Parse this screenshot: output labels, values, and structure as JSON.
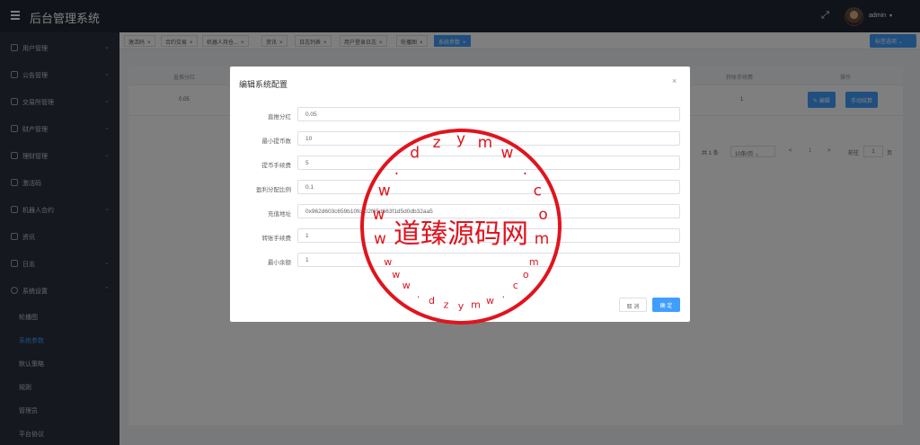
{
  "app": {
    "title": "后台管理系统",
    "user": "admin"
  },
  "sidebar": {
    "items": [
      {
        "label": "用户管理"
      },
      {
        "label": "公告管理"
      },
      {
        "label": "交易所管理"
      },
      {
        "label": "财产管理"
      },
      {
        "label": "理财管理"
      },
      {
        "label": "激活码"
      },
      {
        "label": "机器人合约"
      },
      {
        "label": "资讯"
      },
      {
        "label": "日志"
      },
      {
        "label": "系统设置"
      }
    ],
    "sub_items": [
      {
        "label": "轮播图"
      },
      {
        "label": "系统参数"
      },
      {
        "label": "默认策略"
      },
      {
        "label": "规则"
      },
      {
        "label": "管理员"
      },
      {
        "label": "平台协议"
      }
    ]
  },
  "tabs": [
    {
      "label": "激活码"
    },
    {
      "label": "合约交易"
    },
    {
      "label": "机器人持仓..."
    },
    {
      "label": "资讯"
    },
    {
      "label": "日志列表"
    },
    {
      "label": "用户登录日志"
    },
    {
      "label": "轮播图"
    },
    {
      "label": "系统参数"
    }
  ],
  "tab_options": "标签选项",
  "table": {
    "headers": {
      "direct_bonus": "直推分红",
      "transfer_fee": "转账手续费",
      "actions": "操作"
    },
    "row": {
      "direct_bonus": "0.05",
      "transfer_fee": "1"
    },
    "edit_label": "编辑",
    "manual_label": "手动结算"
  },
  "pagination": {
    "total": "共 1 条",
    "page_size": "10条/页",
    "prev": "<",
    "page": "1",
    "next": ">",
    "goto": "前往",
    "goto_value": "1",
    "page_unit": "页"
  },
  "dialog": {
    "title": "编辑系统配置",
    "fields": [
      {
        "label": "直推分红",
        "value": "0.05"
      },
      {
        "label": "最小提币数",
        "value": "10"
      },
      {
        "label": "提币手续费",
        "value": "5"
      },
      {
        "label": "盈利分配比例",
        "value": "0.1"
      },
      {
        "label": "充值地址",
        "value": "0x962d603c659b10fc202f65d663f1d5d0db32aa5"
      },
      {
        "label": "转账手续费",
        "value": "1"
      },
      {
        "label": "最小余额",
        "value": "1"
      }
    ],
    "cancel_label": "取 消",
    "confirm_label": "确 定"
  },
  "watermark": {
    "center_text": "道臻源码网",
    "top_letters": [
      "w",
      "w",
      "w",
      ".",
      "d",
      "z",
      "y",
      "m",
      "w",
      ".",
      "c",
      "o",
      "m"
    ],
    "bottom_letters": [
      "w",
      "w",
      "w",
      ".",
      "d",
      "z",
      "y",
      "m",
      "w",
      ".",
      "c",
      "o",
      "m"
    ],
    "color": "#e0141e"
  },
  "colors": {
    "primary": "#409eff",
    "header": "#202733",
    "sidebar": "#2a313d"
  }
}
